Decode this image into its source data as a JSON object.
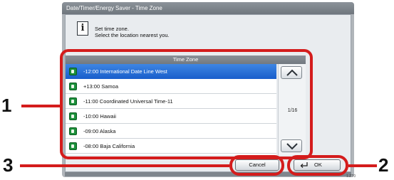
{
  "window": {
    "title": "Date/Timer/Energy Saver - Time Zone"
  },
  "info": {
    "line1": "Set time zone.",
    "line2": "Select the location nearest you."
  },
  "list": {
    "header": "Time Zone",
    "items": [
      {
        "label": "-12:00 International Date Line West",
        "selected": true
      },
      {
        "label": "+13:00 Samoa",
        "selected": false
      },
      {
        "label": "-11:00 Coordinated Universal Time-11",
        "selected": false
      },
      {
        "label": "-10:00 Hawaii",
        "selected": false
      },
      {
        "label": "-09:00 Alaska",
        "selected": false
      },
      {
        "label": "-08:00 Baja California",
        "selected": false
      }
    ],
    "page_indicator": "1/16"
  },
  "buttons": {
    "cancel": "Cancel",
    "ok": "OK"
  },
  "callouts": {
    "one": "1",
    "two": "2",
    "three": "3"
  },
  "corner_code": "1.ZT0",
  "colors": {
    "callout": "#d41c1c",
    "selection": "#1a5fcc"
  },
  "icons": {
    "info": "info-icon",
    "row": "globe-icon",
    "up": "chevron-up-icon",
    "down": "chevron-down-icon",
    "enter": "enter-icon"
  }
}
